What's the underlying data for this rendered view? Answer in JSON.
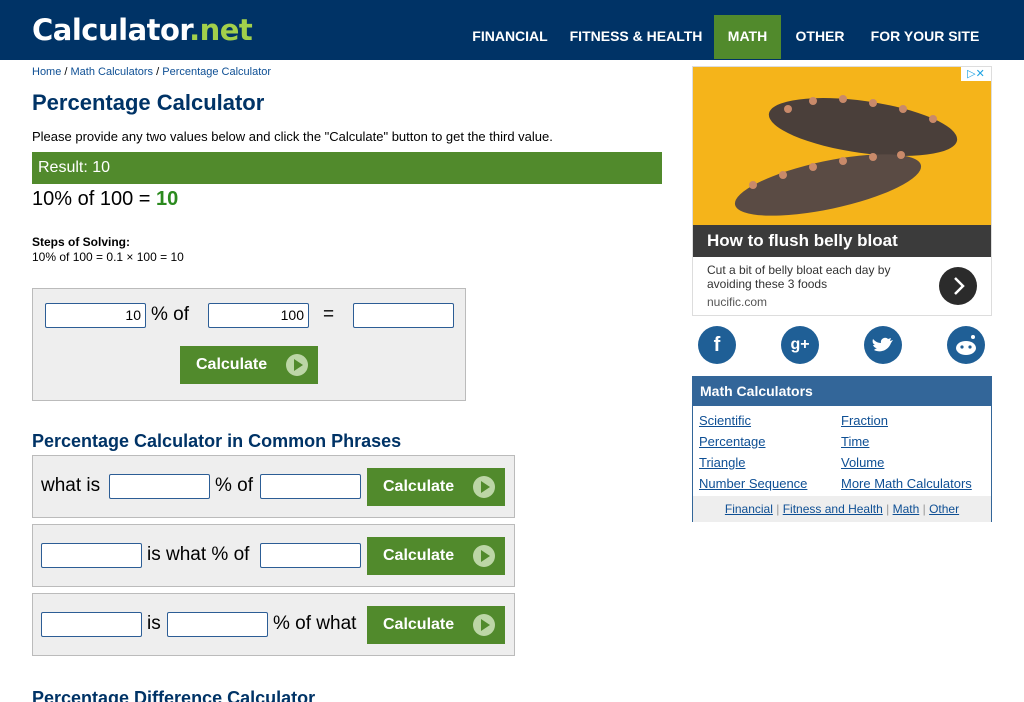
{
  "header": {
    "logo_main": "Calculator",
    "logo_suffix": ".net",
    "nav": [
      "FINANCIAL",
      "FITNESS & HEALTH",
      "MATH",
      "OTHER",
      "FOR YOUR SITE"
    ],
    "active_nav": "MATH"
  },
  "breadcrumb": {
    "items": [
      "Home",
      "Math Calculators",
      "Percentage Calculator"
    ],
    "separator": " / "
  },
  "page": {
    "title": "Percentage Calculator",
    "intro": "Please provide any two values below and click the \"Calculate\" button to get the third value.",
    "result_bar": "Result: 10",
    "result_expr": "10% of 100 = ",
    "result_value": "10",
    "steps_title": "Steps of Solving:",
    "steps_text": "10% of 100 = 0.1 × 100 = 10"
  },
  "main_calc": {
    "value1": "10",
    "label_pct_of": "% of",
    "value2": "100",
    "equals": "=",
    "value3": "",
    "button": "Calculate"
  },
  "phrases": {
    "title": "Percentage Calculator in Common Phrases",
    "row1": {
      "prefix": "what is",
      "mid": "% of",
      "button": "Calculate"
    },
    "row2": {
      "mid": "is what % of",
      "button": "Calculate"
    },
    "row3": {
      "mid": "is",
      "suffix": "% of what",
      "button": "Calculate"
    }
  },
  "next_section_title": "Percentage Difference Calculator",
  "ad": {
    "headline": "How to flush belly bloat",
    "body": "Cut a bit of belly bloat each day by avoiding these 3 foods",
    "domain": "nucific.com",
    "badge": "▷✕"
  },
  "social": [
    "f",
    "g+",
    "twitter",
    "reddit"
  ],
  "math_box": {
    "title": "Math Calculators",
    "left": [
      "Scientific",
      "Percentage",
      "Triangle",
      "Number Sequence"
    ],
    "right": [
      "Fraction",
      "Time",
      "Volume",
      "More Math Calculators"
    ],
    "footer": [
      "Financial",
      "Fitness and Health",
      "Math",
      "Other"
    ],
    "footer_sep": "|"
  },
  "colors": {
    "header_bg": "#003366",
    "accent_green": "#518a2c",
    "link_blue": "#0e4f94",
    "title_blue": "#003366"
  }
}
